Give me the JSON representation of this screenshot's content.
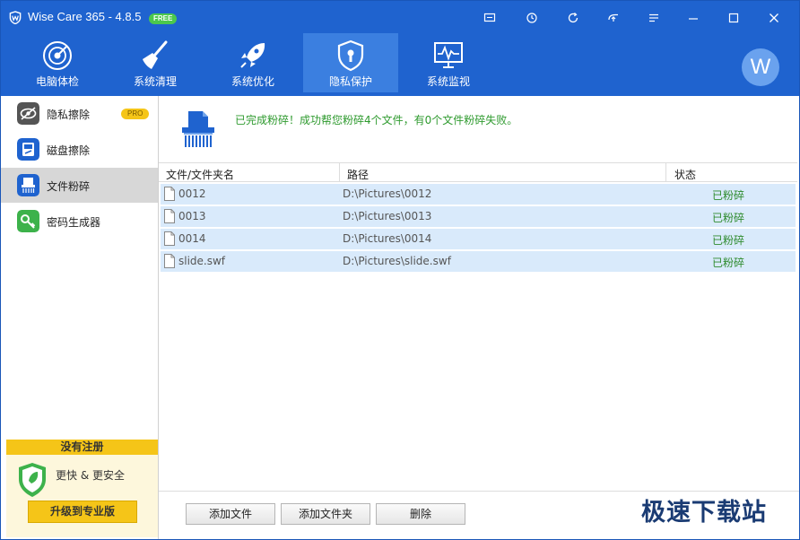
{
  "titlebar": {
    "title": "Wise Care 365 - 4.8.5",
    "badge": "FREE",
    "buttons": [
      "chat-icon",
      "history-icon",
      "refresh-icon",
      "share-icon",
      "menu-icon",
      "minimize-icon",
      "maximize-icon",
      "close-icon"
    ]
  },
  "nav": {
    "items": [
      {
        "label": "电脑体检",
        "icon": "radar-icon"
      },
      {
        "label": "系统清理",
        "icon": "broom-icon"
      },
      {
        "label": "系统优化",
        "icon": "rocket-icon"
      },
      {
        "label": "隐私保护",
        "icon": "shield-lock-icon",
        "active": true
      },
      {
        "label": "系统监视",
        "icon": "monitor-icon"
      }
    ],
    "avatar_letter": "W"
  },
  "sidebar": {
    "items": [
      {
        "label": "隐私擦除",
        "badge": "PRO"
      },
      {
        "label": "磁盘擦除"
      },
      {
        "label": "文件粉碎",
        "active": true
      },
      {
        "label": "密码生成器"
      }
    ],
    "promo": {
      "header": "没有注册",
      "text": "更快 & 更安全",
      "button": "升级到专业版"
    }
  },
  "main": {
    "message": "已完成粉碎！成功帮您粉碎4个文件，有0个文件粉碎失败。",
    "columns": [
      "文件/文件夹名",
      "路径",
      "状态"
    ],
    "rows": [
      {
        "name": "0012",
        "path": "D:\\Pictures\\0012",
        "status": "已粉碎"
      },
      {
        "name": "0013",
        "path": "D:\\Pictures\\0013",
        "status": "已粉碎"
      },
      {
        "name": "0014",
        "path": "D:\\Pictures\\0014",
        "status": "已粉碎"
      },
      {
        "name": "slide.swf",
        "path": "D:\\Pictures\\slide.swf",
        "status": "已粉碎"
      }
    ],
    "buttons": {
      "add_file": "添加文件",
      "add_folder": "添加文件夹",
      "delete": "删除"
    }
  },
  "watermark": "极速下载站",
  "colors": {
    "brand": "#1f63cf",
    "nav_active": "#3b7fe0",
    "success": "#2e9a2e",
    "promo": "#f5c518"
  }
}
